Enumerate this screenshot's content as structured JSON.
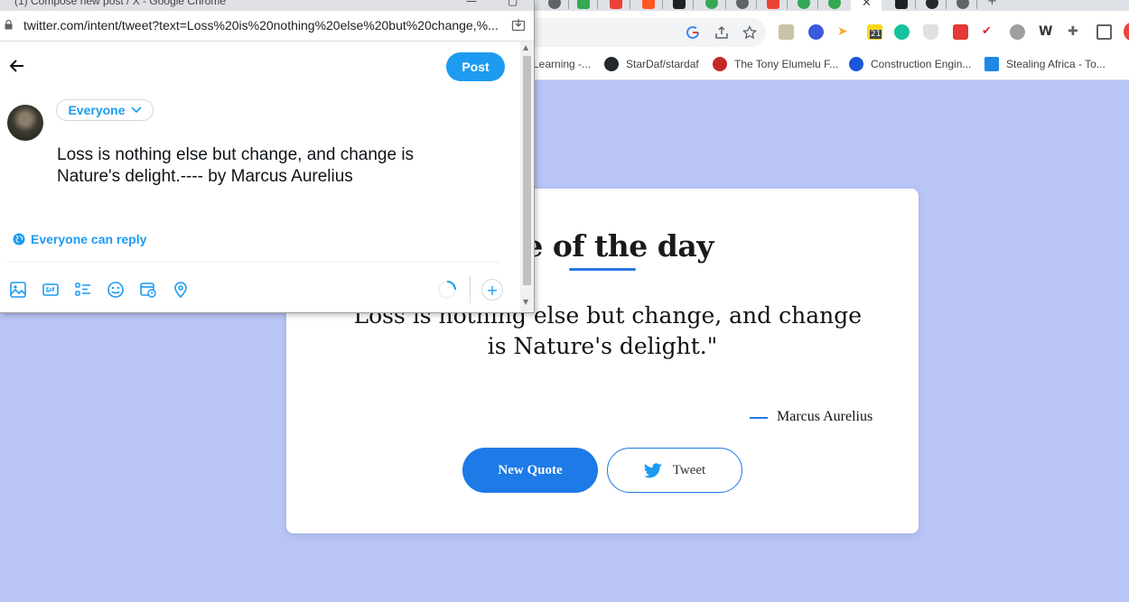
{
  "background_browser": {
    "tabs": [
      {
        "color": "#5f6368"
      },
      {
        "color": "#34a853"
      },
      {
        "color": "#ea4335"
      },
      {
        "color": "#ff5722"
      },
      {
        "color": "#202124"
      },
      {
        "color": "#34a853"
      },
      {
        "color": "#5f6368"
      },
      {
        "color": "#ea4335"
      },
      {
        "color": "#34a853"
      },
      {
        "color": "#34a853"
      }
    ],
    "active_tab_close": "✕",
    "bookmarks": [
      {
        "label": "Learning -...",
        "color": "#f4b400"
      },
      {
        "label": "StarDaf/stardaf",
        "color": "#24292e"
      },
      {
        "label": "The Tony Elumelu F...",
        "color": "#c62828"
      },
      {
        "label": "Construction Engin...",
        "color": "#1a56db"
      },
      {
        "label": "Stealing Africa - To...",
        "color": "#1e88e5"
      }
    ],
    "extension_badge": "21"
  },
  "quote_page": {
    "title": "ote of the day",
    "quote": "\"Loss is nothing else but change, and change is Nature's delight.\"",
    "author": "Marcus Aurelius",
    "new_quote_label": "New Quote",
    "tweet_label": "Tweet",
    "accent_color": "#1d7ae6"
  },
  "popup": {
    "window_title": "(1) Compose new post / X - Google Chrome",
    "url": "twitter.com/intent/tweet?text=Loss%20is%20nothing%20else%20but%20change,%...",
    "post_label": "Post",
    "audience_label": "Everyone",
    "tweet_text": "Loss is nothing else but change, and change is Nature's delight.---- by Marcus Aurelius",
    "reply_setting": "Everyone can reply",
    "add_thread": "+",
    "accent_color": "#1d9bf0"
  }
}
